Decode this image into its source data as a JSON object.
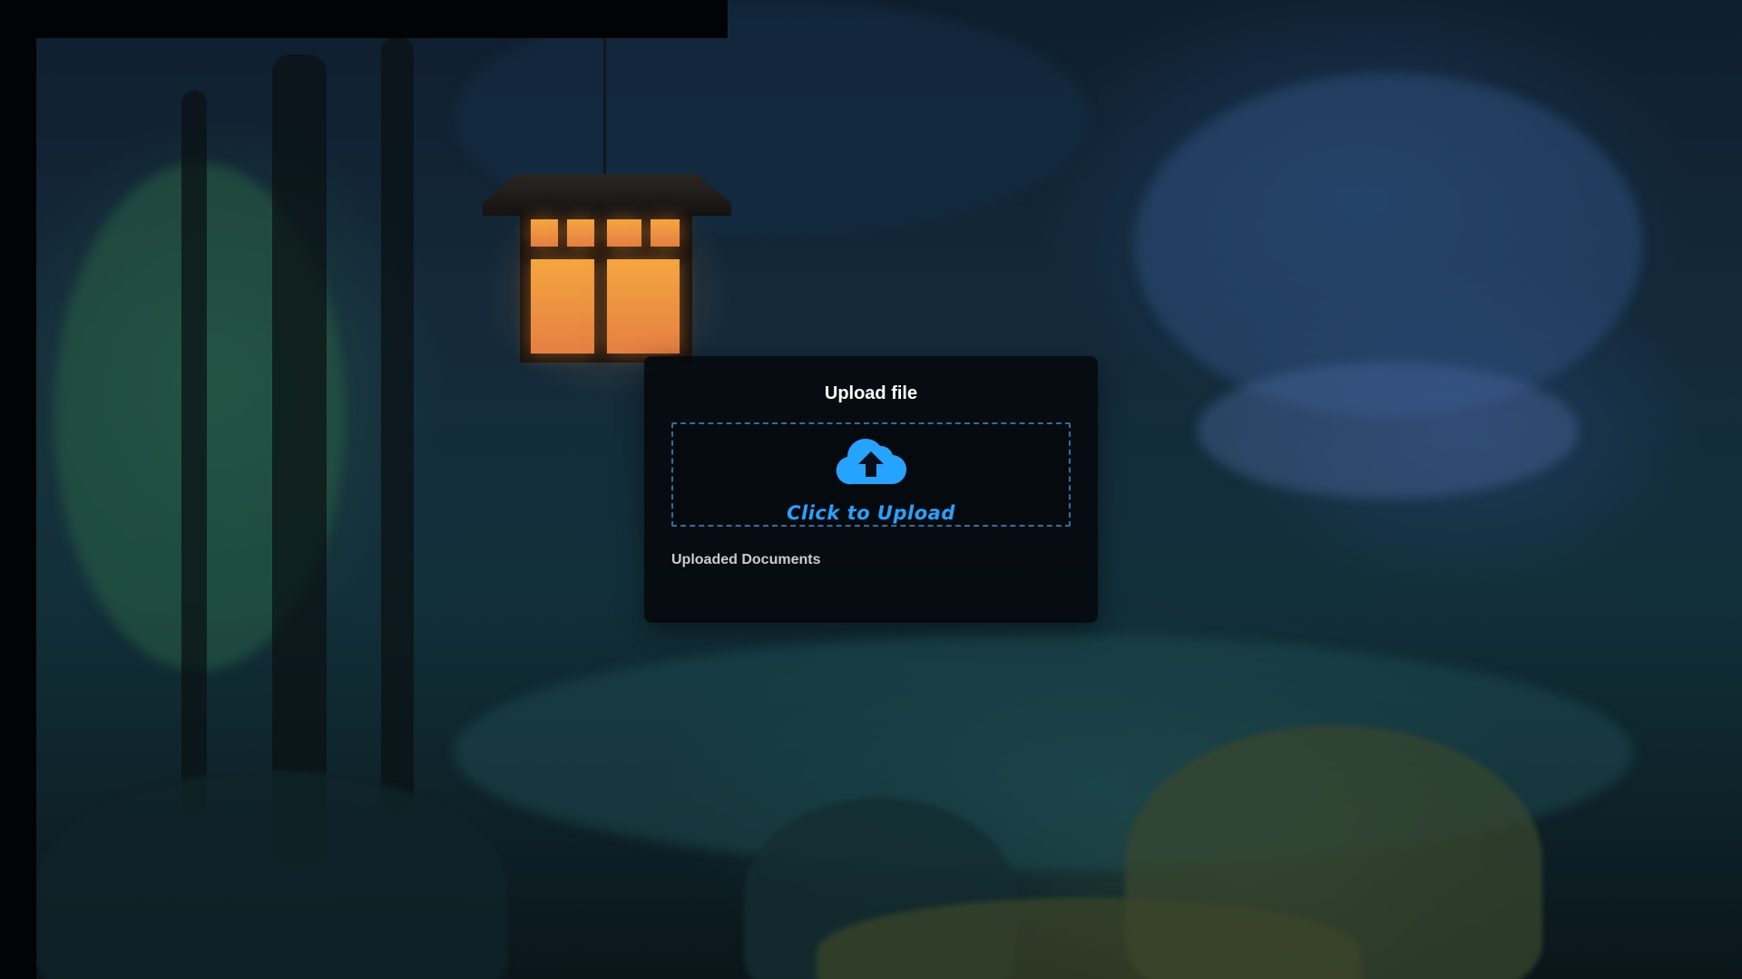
{
  "upload": {
    "title": "Upload file",
    "dropzone_label": "Click to Upload",
    "dropzone_icon": "cloud-upload-icon",
    "uploaded_label": "Uploaded Documents",
    "uploaded_items": []
  },
  "colors": {
    "accent": "#25a3ff",
    "dropzone_border": "#2f6f9d",
    "card_background": "#04080d"
  }
}
